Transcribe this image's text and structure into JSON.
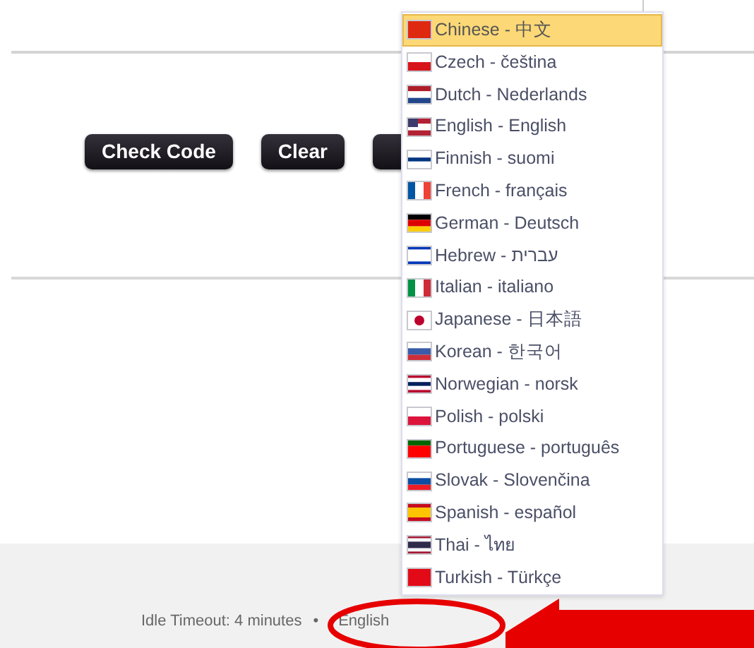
{
  "buttons": [
    {
      "label": "Check Code"
    },
    {
      "label": "Clear"
    },
    {
      "kind": "hidden"
    }
  ],
  "language_menu": {
    "items": [
      {
        "label": "Chinese - 中文",
        "selected": true
      },
      {
        "label": "Czech - čeština",
        "selected": false
      },
      {
        "label": "Dutch - Nederlands",
        "selected": false
      },
      {
        "label": "English - English",
        "selected": false
      },
      {
        "label": "Finnish - suomi",
        "selected": false
      },
      {
        "label": "French - français",
        "selected": false
      },
      {
        "label": "German - Deutsch",
        "selected": false
      },
      {
        "label": "Hebrew - עברית",
        "selected": false
      },
      {
        "label": "Italian - italiano",
        "selected": false
      },
      {
        "label": "Japanese - 日本語",
        "selected": false
      },
      {
        "label": "Korean - 한국어",
        "selected": false
      },
      {
        "label": "Norwegian - norsk",
        "selected": false
      },
      {
        "label": "Polish - polski",
        "selected": false
      },
      {
        "label": "Portuguese - português",
        "selected": false
      },
      {
        "label": "Slovak - Slovenčina",
        "selected": false
      },
      {
        "label": "Spanish - español",
        "selected": false
      },
      {
        "label": "Thai - ไทย",
        "selected": false
      },
      {
        "label": "Turkish - Türkçe",
        "selected": false
      }
    ]
  },
  "footer": {
    "idle_timeout": "Idle Timeout: 4 minutes",
    "separator": "•",
    "language_link": "English"
  }
}
